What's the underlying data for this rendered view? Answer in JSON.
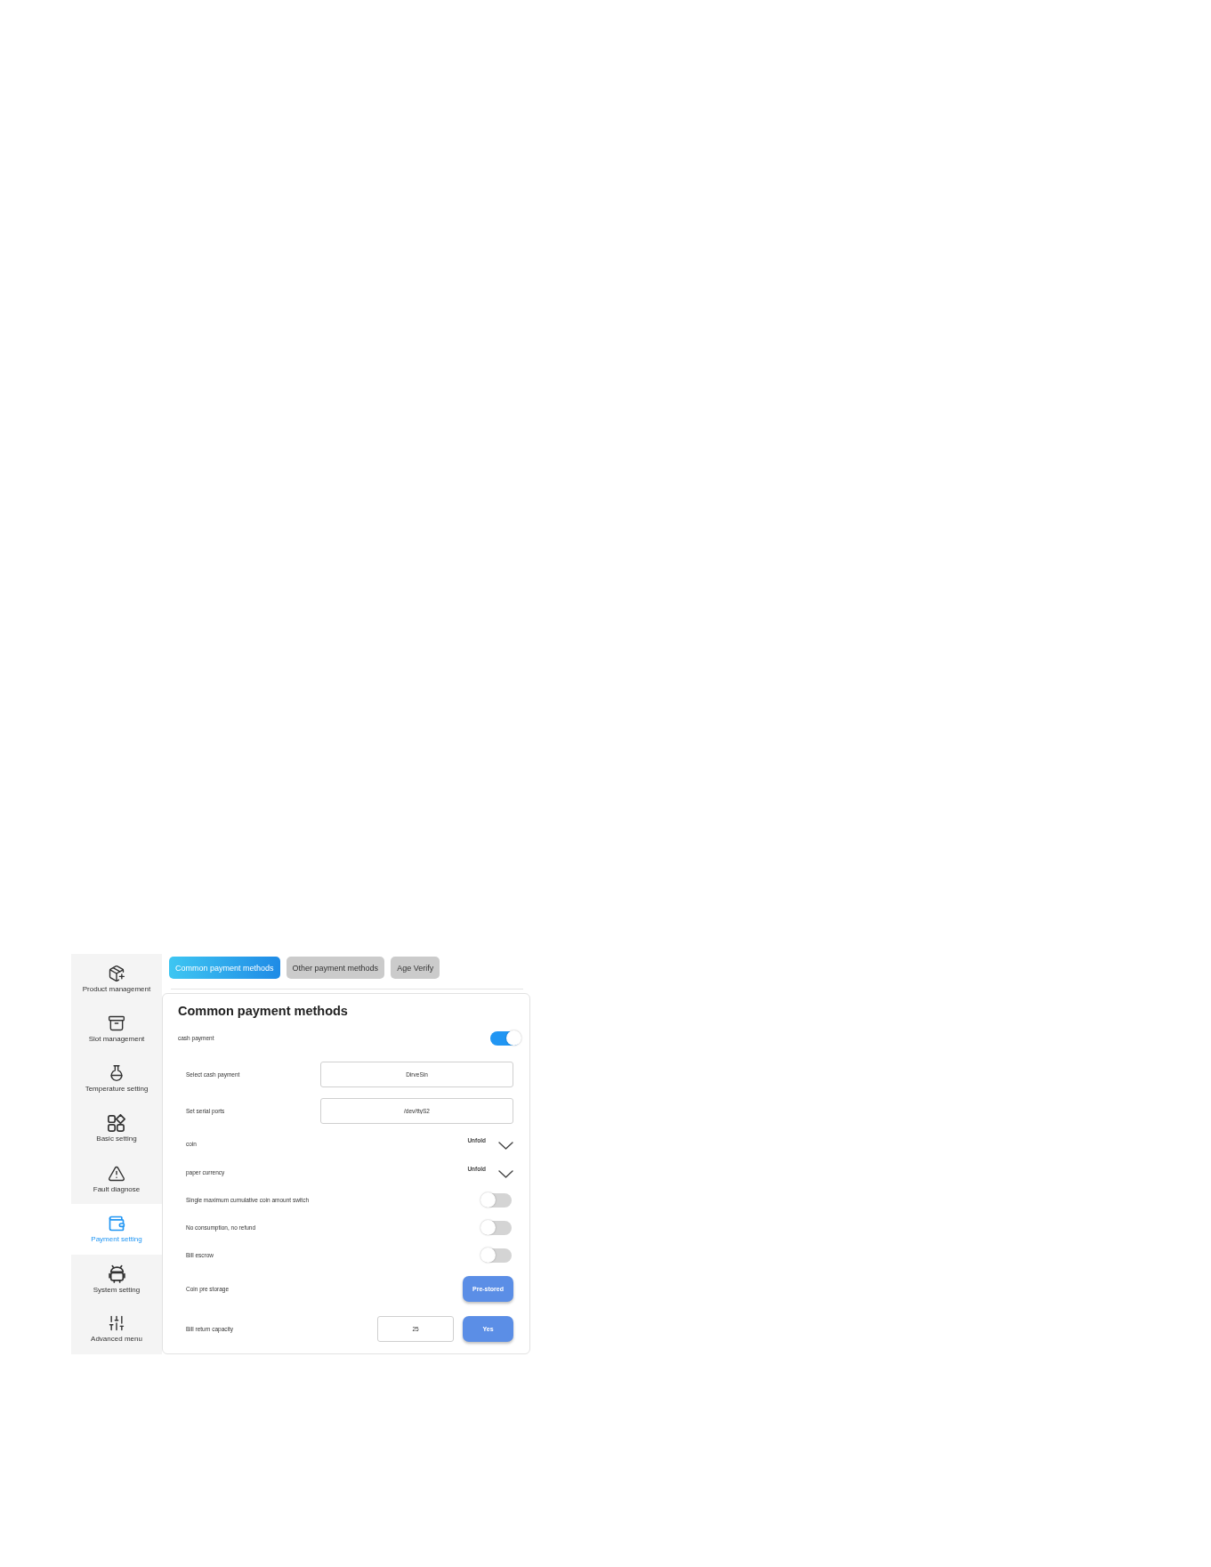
{
  "sidebar": {
    "items": [
      {
        "label": "Product management",
        "selected": false
      },
      {
        "label": "Slot management",
        "selected": false
      },
      {
        "label": "Temperature setting",
        "selected": false
      },
      {
        "label": "Basic setting",
        "selected": false
      },
      {
        "label": "Fault diagnose",
        "selected": false
      },
      {
        "label": "Payment setting",
        "selected": true
      },
      {
        "label": "System setting",
        "selected": false
      },
      {
        "label": "Advanced menu",
        "selected": false
      }
    ]
  },
  "tabs": [
    {
      "label": "Common payment methods",
      "selected": true
    },
    {
      "label": "Other payment methods",
      "selected": false
    },
    {
      "label": "Age Verify",
      "selected": false
    }
  ],
  "panel": {
    "title": "Common payment methods",
    "cash_payment": {
      "label": "cash payment",
      "on": true
    },
    "options": [
      {
        "kind": "field",
        "label": "Select cash payment",
        "value": "DirveSin"
      },
      {
        "kind": "field",
        "label": "Set serial ports",
        "value": "/dev/ttyS2"
      },
      {
        "kind": "dropdown",
        "label": "coin",
        "action": "Unfold",
        "expanded": false
      },
      {
        "kind": "dropdown",
        "label": "paper currency",
        "action": "Unfold",
        "expanded": false
      },
      {
        "kind": "switch",
        "label": "Single maximum cumulative coin amount switch",
        "on": false
      },
      {
        "kind": "switch",
        "label": "No consumption, no refund",
        "on": false
      },
      {
        "kind": "switch",
        "label": "Bill escrow",
        "on": false
      },
      {
        "kind": "button",
        "label": "Coin pre storage",
        "button": "Pre-stored"
      },
      {
        "kind": "input-button",
        "label": "Bill return capacity",
        "value": "25",
        "button": "Yes"
      }
    ]
  }
}
